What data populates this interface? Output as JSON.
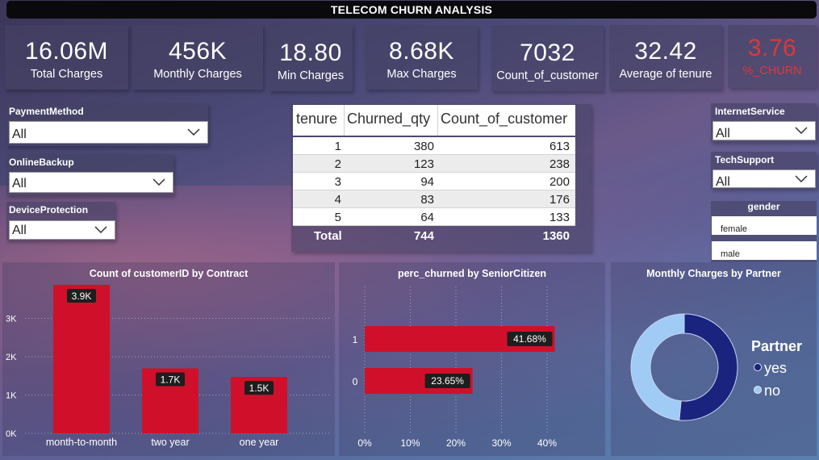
{
  "title": "TELECOM CHURN ANALYSIS",
  "kpis": [
    {
      "value": "16.06M",
      "label": "Total Charges"
    },
    {
      "value": "456K",
      "label": "Monthly Charges"
    },
    {
      "value": "18.80",
      "label": "Min Charges"
    },
    {
      "value": "8.68K",
      "label": "Max Charges"
    },
    {
      "value": "7032",
      "label": "Count_of_customer"
    },
    {
      "value": "32.42",
      "label": "Average of tenure"
    },
    {
      "value": "3.76",
      "label": "%_CHURN"
    }
  ],
  "slicers": {
    "payment": {
      "title": "PaymentMethod",
      "value": "All"
    },
    "backup": {
      "title": "OnlineBackup",
      "value": "All"
    },
    "protection": {
      "title": "DeviceProtection",
      "value": "All"
    },
    "internet": {
      "title": "InternetService",
      "value": "All"
    },
    "techsupport": {
      "title": "TechSupport",
      "value": "All"
    },
    "gender": {
      "title": "gender",
      "options": [
        "female",
        "male"
      ]
    }
  },
  "table": {
    "headers": [
      "tenure",
      "Churned_qty",
      "Count_of_customer"
    ],
    "rows": [
      [
        "1",
        "380",
        "613"
      ],
      [
        "2",
        "123",
        "238"
      ],
      [
        "3",
        "94",
        "200"
      ],
      [
        "4",
        "83",
        "176"
      ],
      [
        "5",
        "64",
        "133"
      ]
    ],
    "total": [
      "Total",
      "744",
      "1360"
    ]
  },
  "colors": {
    "bar": "#d0102a",
    "dark_blue": "#1a237e",
    "light_blue": "#a0cbf5",
    "churn_red": "#d93a3a"
  },
  "chart_data": [
    {
      "type": "bar",
      "title": "Count of customerID by Contract",
      "categories": [
        "month-to-month",
        "two year",
        "one year"
      ],
      "values": [
        3875,
        1695,
        1472
      ],
      "data_labels": [
        "3.9K",
        "1.7K",
        "1.5K"
      ],
      "yticks": [
        "0K",
        "1K",
        "2K",
        "3K"
      ],
      "ylim": [
        0,
        4000
      ],
      "grid": true
    },
    {
      "type": "bar",
      "orientation": "horizontal",
      "title": "perc_churned by SeniorCitizen",
      "categories": [
        "1",
        "0"
      ],
      "values": [
        41.68,
        23.65
      ],
      "data_labels": [
        "41.68%",
        "23.65%"
      ],
      "xticks": [
        "0%",
        "10%",
        "20%",
        "30%",
        "40%"
      ],
      "xlim": [
        0,
        42
      ],
      "grid": true
    },
    {
      "type": "pie",
      "donut": true,
      "title": "Monthly Charges by Partner",
      "legend_title": "Partner",
      "categories": [
        "yes",
        "no"
      ],
      "values": [
        51.5,
        48.5
      ],
      "legend_position": "right"
    }
  ]
}
